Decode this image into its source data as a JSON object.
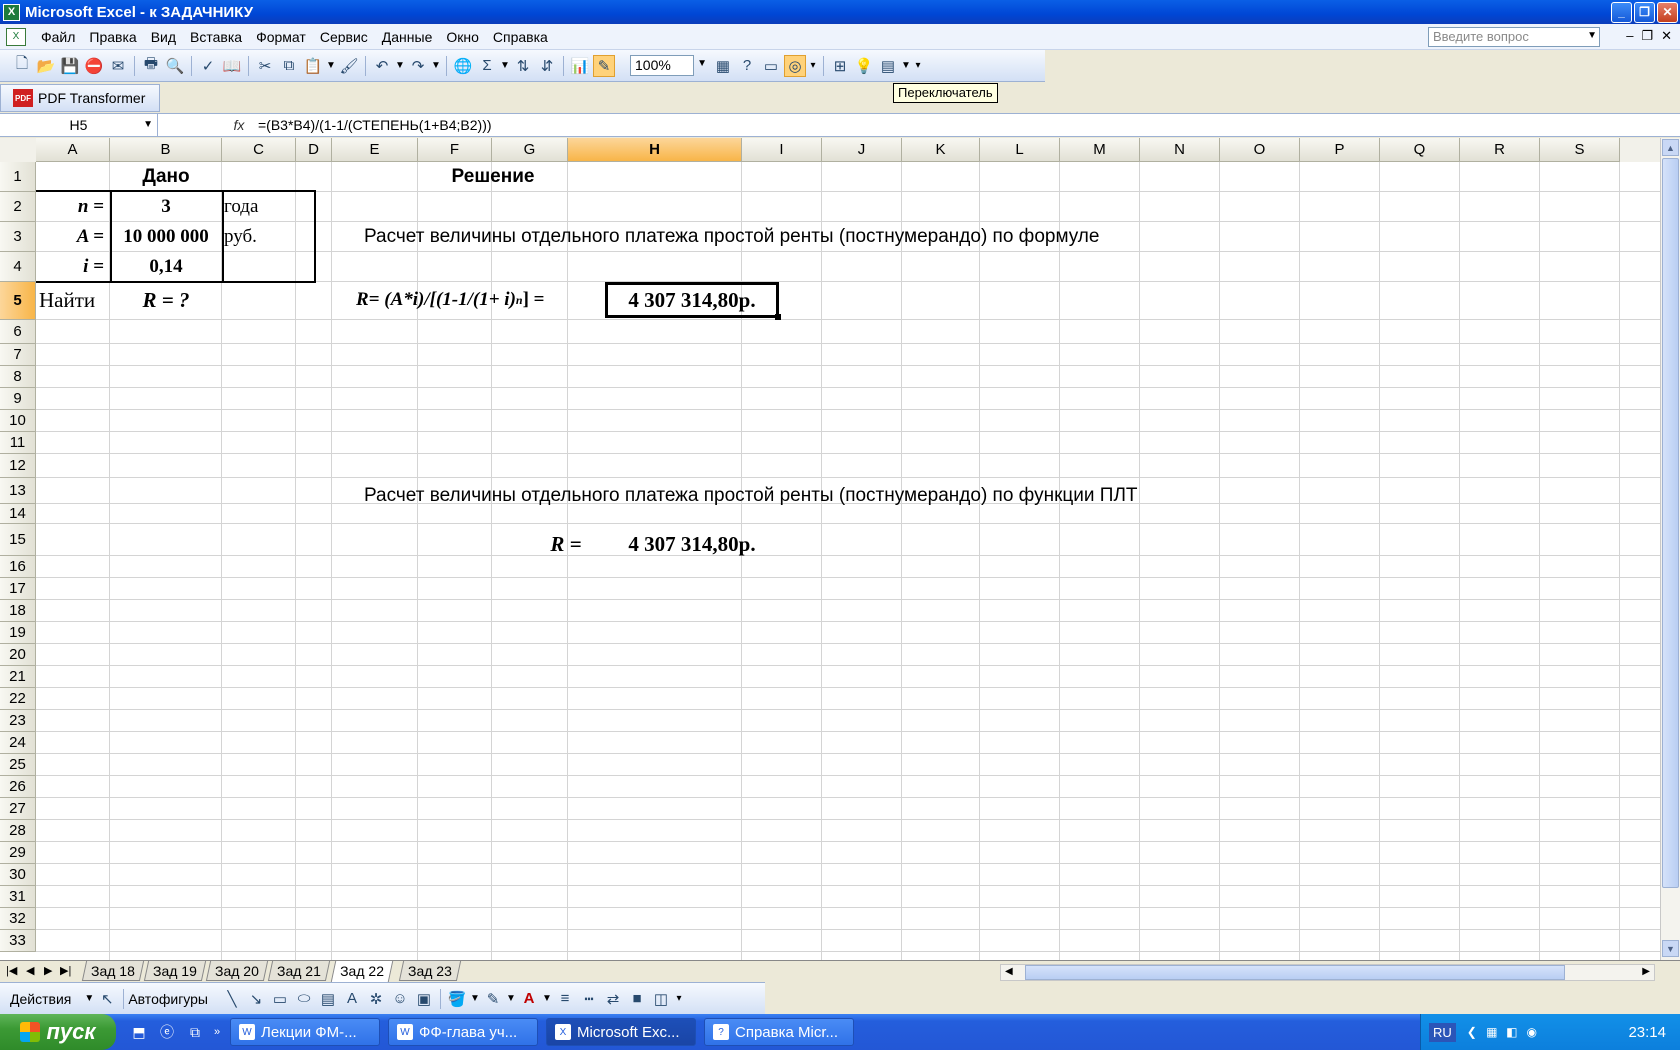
{
  "window": {
    "title": "Microsoft Excel - к ЗАДАЧНИКУ",
    "app_icon": "excel-icon"
  },
  "menu": {
    "items": [
      "Файл",
      "Правка",
      "Вид",
      "Вставка",
      "Формат",
      "Сервис",
      "Данные",
      "Окно",
      "Справка"
    ],
    "help_placeholder": "Введите вопрос"
  },
  "toolbar": {
    "zoom": "100%",
    "tooltip": "Переключатель"
  },
  "pdfbar": {
    "label": "PDF Transformer",
    "icon_text": "PDF"
  },
  "formula_bar": {
    "name_box": "H5",
    "fx": "fx",
    "formula": "=(B3*B4)/(1-1/(СТЕПЕНЬ(1+B4;B2)))"
  },
  "columns": [
    "A",
    "B",
    "C",
    "D",
    "E",
    "F",
    "G",
    "H",
    "I",
    "J",
    "K",
    "L",
    "M",
    "N",
    "O",
    "P",
    "Q",
    "R",
    "S"
  ],
  "selected_column": "H",
  "rows": [
    "1",
    "2",
    "3",
    "4",
    "5",
    "6",
    "7",
    "8",
    "9",
    "10",
    "11",
    "12",
    "13",
    "14",
    "15",
    "16",
    "17",
    "18",
    "19",
    "20",
    "21",
    "22",
    "23",
    "24",
    "25",
    "26",
    "27",
    "28",
    "29",
    "30",
    "31",
    "32",
    "33"
  ],
  "selected_row": "5",
  "cells": {
    "b1": "Дано",
    "f1": "Решение",
    "a2": "n =",
    "b2": "3",
    "c2": "года",
    "a3": "A =",
    "b3": "10 000 000",
    "c3": "руб.",
    "a4": "i =",
    "b4": "0,14",
    "a5": "Найти",
    "b5": "R = ?",
    "e3": "Расчет величины отдельного платежа простой ренты (постнумерандо) по формуле",
    "e5": "R= (A*i)/[(1-1/(1+ i)",
    "e5_sup": "n",
    "e5_end": " ]  =",
    "h5": "4 307 314,80р.",
    "e13": "Расчет величины отдельного платежа простой ренты (постнумерандо) по функции ПЛТ",
    "g15": "R   =",
    "h15": "4 307 314,80р."
  },
  "sheets": [
    "Зад 18",
    "Зад 19",
    "Зад 20",
    "Зад 21",
    "Зад 22",
    "Зад 23"
  ],
  "active_sheet": "Зад 22",
  "drawbar": {
    "actions": "Действия",
    "autoshapes": "Автофигуры"
  },
  "taskbar": {
    "start": "пуск",
    "tasks": [
      "Лекции ФМ-...",
      "ФФ-глава уч...",
      "Microsoft Exc...",
      "Справка Micr..."
    ],
    "active_task": 2,
    "lang": "RU",
    "clock": "23:14"
  }
}
